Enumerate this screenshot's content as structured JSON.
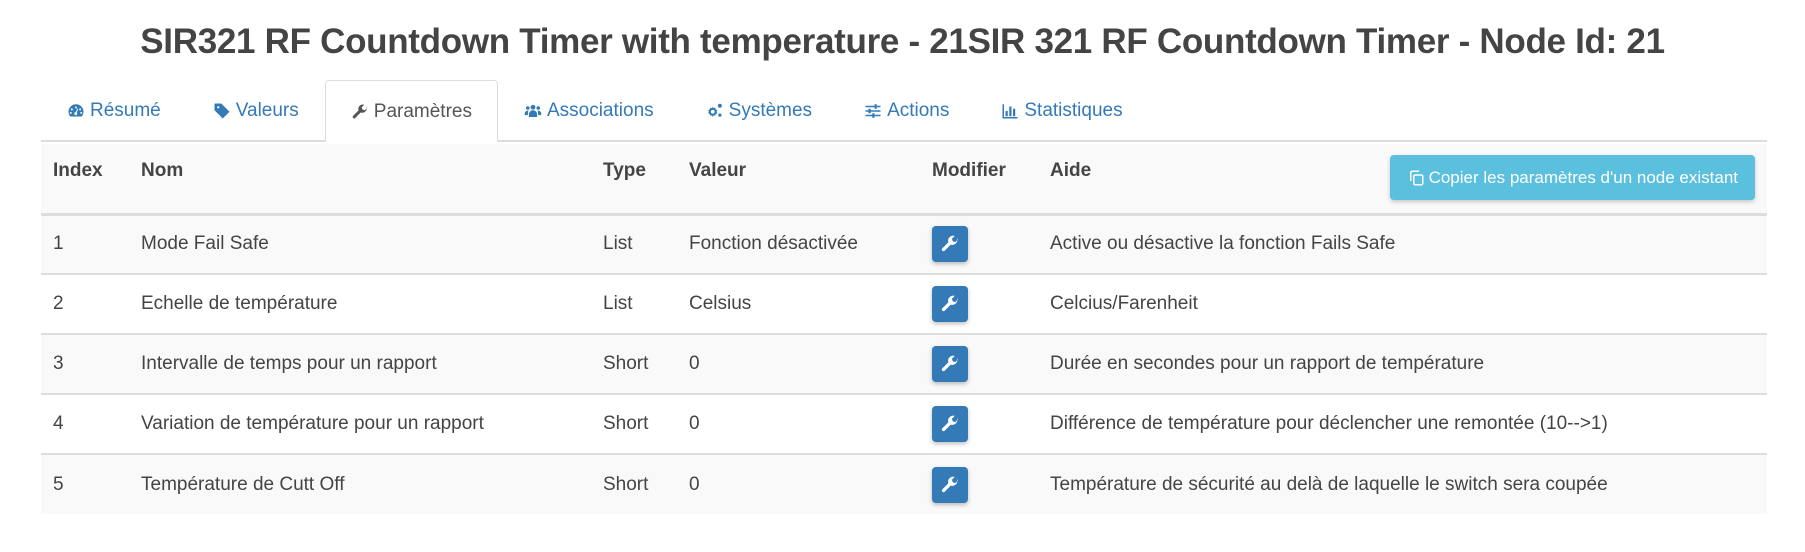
{
  "page": {
    "title": "SIR321 RF Countdown Timer with temperature - 21SIR 321 RF Countdown Timer - Node Id: 21"
  },
  "tabs": [
    {
      "label": "Résumé",
      "icon": "dashboard-icon",
      "active": false
    },
    {
      "label": "Valeurs",
      "icon": "tag-icon",
      "active": false
    },
    {
      "label": "Paramètres",
      "icon": "wrench-icon",
      "active": true
    },
    {
      "label": "Associations",
      "icon": "users-icon",
      "active": false
    },
    {
      "label": "Systèmes",
      "icon": "cogs-icon",
      "active": false
    },
    {
      "label": "Actions",
      "icon": "sliders-icon",
      "active": false
    },
    {
      "label": "Statistiques",
      "icon": "bar-chart-icon",
      "active": false
    }
  ],
  "colors": {
    "link": "#337ab7",
    "primary_button": "#337ab7",
    "info_button": "#5bc0de",
    "text": "#444444"
  },
  "table": {
    "headers": {
      "index": "Index",
      "nom": "Nom",
      "type": "Type",
      "valeur": "Valeur",
      "modifier": "Modifier",
      "aide": "Aide"
    },
    "copy_button": "Copier les paramètres d'un node existant",
    "rows": [
      {
        "index": "1",
        "nom": "Mode Fail Safe",
        "type": "List",
        "valeur": "Fonction désactivée",
        "aide": "Active ou désactive la fonction Fails Safe"
      },
      {
        "index": "2",
        "nom": "Echelle de température",
        "type": "List",
        "valeur": "Celsius",
        "aide": "Celcius/Farenheit"
      },
      {
        "index": "3",
        "nom": "Intervalle de temps pour un rapport",
        "type": "Short",
        "valeur": "0",
        "aide": "Durée en secondes pour un rapport de température"
      },
      {
        "index": "4",
        "nom": "Variation de température pour un rapport",
        "type": "Short",
        "valeur": "0",
        "aide": "Différence de température pour déclencher une remontée (10-->1)"
      },
      {
        "index": "5",
        "nom": "Température de Cutt Off",
        "type": "Short",
        "valeur": "0",
        "aide": "Température de sécurité au delà de laquelle le switch sera coupée"
      }
    ]
  }
}
